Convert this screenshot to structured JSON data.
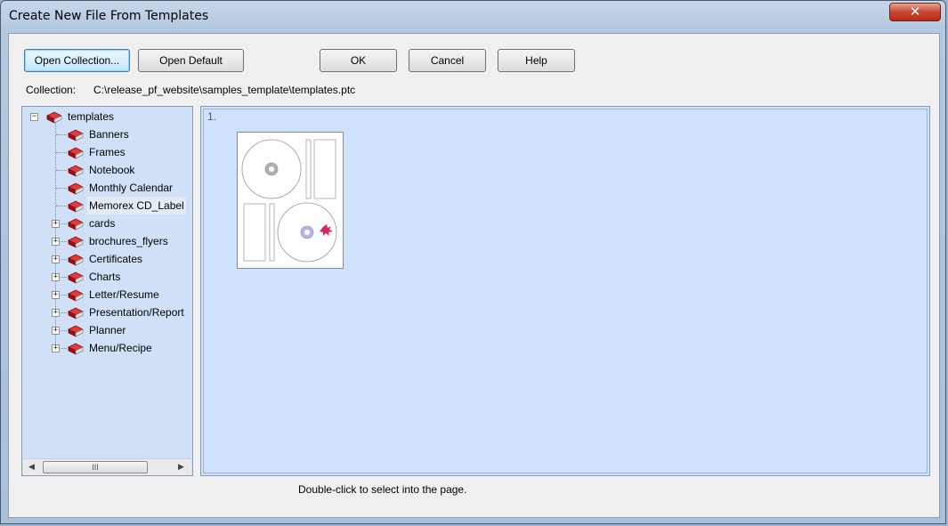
{
  "window": {
    "title": "Create New File From Templates",
    "close_glyph": "✕"
  },
  "toolbar": {
    "open_collection_label": "Open Collection...",
    "open_default_label": "Open Default",
    "ok_label": "OK",
    "cancel_label": "Cancel",
    "help_label": "Help"
  },
  "collection": {
    "label": "Collection:",
    "path": "C:\\release_pf_website\\samples_template\\templates.ptc"
  },
  "tree": {
    "root": {
      "label": "templates",
      "expander": "−",
      "icon": "book-icon"
    },
    "children": [
      {
        "label": "Banners",
        "expander": ""
      },
      {
        "label": "Frames",
        "expander": ""
      },
      {
        "label": "Notebook",
        "expander": ""
      },
      {
        "label": "Monthly Calendar",
        "expander": ""
      },
      {
        "label": "Memorex CD_Label",
        "expander": "",
        "selected": true
      },
      {
        "label": "cards",
        "expander": "+"
      },
      {
        "label": "brochures_flyers",
        "expander": "+"
      },
      {
        "label": "Certificates",
        "expander": "+"
      },
      {
        "label": "Charts",
        "expander": "+"
      },
      {
        "label": "Letter/Resume",
        "expander": "+"
      },
      {
        "label": "Presentation/Report",
        "expander": "+"
      },
      {
        "label": "Planner",
        "expander": "+"
      },
      {
        "label": "Menu/Recipe",
        "expander": "+"
      }
    ],
    "scroll": {
      "left_arrow": "◀",
      "right_arrow": "▶",
      "thumb_grip": "III"
    }
  },
  "preview": {
    "item_index": "1."
  },
  "status": {
    "hint": "Double-click to select into the page."
  },
  "colors": {
    "book_red": "#c8101e",
    "panel_bg": "#cfe2fd",
    "tree_bg": "#cfe0f7"
  }
}
